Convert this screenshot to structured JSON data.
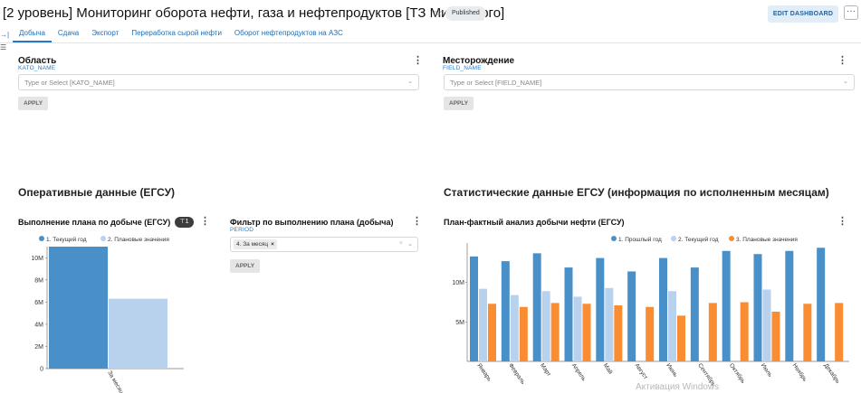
{
  "header": {
    "title": "[2 уровень] Мониторинг оборота нефти, газа и нефтепродуктов [ТЗ МинЭнерго]",
    "status_badge": "Published",
    "edit_button": "EDIT DASHBOARD",
    "more_button": "···"
  },
  "tabs": [
    {
      "label": "Добыча",
      "active": true
    },
    {
      "label": "Сдача",
      "active": false
    },
    {
      "label": "Экспорт",
      "active": false
    },
    {
      "label": "Переработка сырой нефти",
      "active": false
    },
    {
      "label": "Оборот нефтепродуктов на АЗС",
      "active": false
    }
  ],
  "filters": {
    "region": {
      "title": "Область",
      "column": "KATO_NAME",
      "placeholder": "Type or Select [KATO_NAME]",
      "apply": "APPLY"
    },
    "field": {
      "title": "Месторождение",
      "column": "FIELD_NAME",
      "placeholder": "Type or Select [FIELD_NAME]",
      "apply": "APPLY"
    },
    "plan": {
      "title": "Фильтр по выполнению плана (добыча)",
      "column": "PERIOD",
      "selected": "4. За месяц",
      "apply": "APPLY"
    }
  },
  "sections": {
    "operational": "Оперативные данные (ЕГСУ)",
    "statistical": "Статистические данные ЕГСУ (информация по исполненным месяцам)"
  },
  "charts": {
    "plan_title": "Выполнение плана по добыче (ЕГСУ)",
    "plan_filter_count": "1",
    "fact_title": "План-фактный анализ добычи нефти (ЕГСУ)"
  },
  "colors": {
    "series_dark_blue": "#4a90c8",
    "series_light_blue": "#b8d2ee",
    "series_orange": "#fa8c32"
  },
  "chart_data": [
    {
      "type": "bar",
      "categories": [
        "За месяц"
      ],
      "series": [
        {
          "name": "1. Текущий год",
          "values": [
            11000000
          ]
        },
        {
          "name": "2. Плановые значения",
          "values": [
            6300000
          ]
        }
      ],
      "ylim": [
        0,
        11000000
      ],
      "yticks": [
        "0",
        "2M",
        "4M",
        "6M",
        "8M",
        "10M"
      ],
      "legend": "top-left"
    },
    {
      "type": "bar",
      "categories": [
        "Январь",
        "Февраль",
        "Март",
        "Апрель",
        "Май",
        "Август",
        "Июнь",
        "Сентябрь",
        "Октябрь",
        "Июль",
        "Ноябрь",
        "Декабрь"
      ],
      "series": [
        {
          "name": "1. Прошлый год",
          "values": [
            13300000,
            12700000,
            13700000,
            11900000,
            13100000,
            11400000,
            13100000,
            11900000,
            14000000,
            13600000,
            14000000,
            14400000
          ]
        },
        {
          "name": "2. Текущий год",
          "values": [
            9200000,
            8400000,
            8900000,
            8200000,
            9300000,
            null,
            8900000,
            null,
            null,
            9100000,
            null,
            null
          ]
        },
        {
          "name": "3. Плановые значения",
          "values": [
            7300000,
            6900000,
            7400000,
            7300000,
            7100000,
            6900000,
            5800000,
            7400000,
            7500000,
            6300000,
            7300000,
            7400000
          ]
        }
      ],
      "ylim": [
        0,
        15000000
      ],
      "yticks": [
        "5M",
        "10M"
      ],
      "legend": "top-center"
    }
  ],
  "watermark": "Активация Windows"
}
